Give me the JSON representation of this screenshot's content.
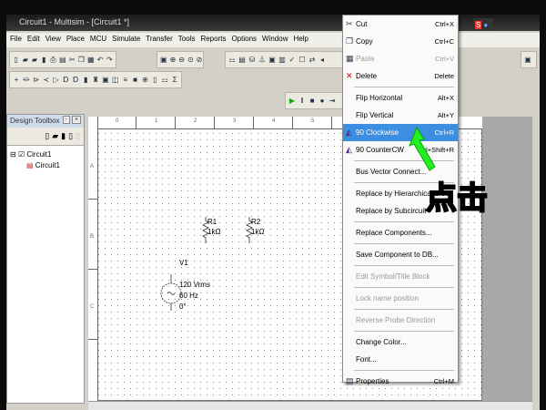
{
  "window": {
    "title": "Circuit1 - Multisim - [Circuit1 *]"
  },
  "menubar": [
    "File",
    "Edit",
    "View",
    "Place",
    "MCU",
    "Simulate",
    "Transfer",
    "Tools",
    "Reports",
    "Options",
    "Window",
    "Help"
  ],
  "design_toolbox": {
    "title": "Design Toolbox",
    "tree": {
      "root": "Circuit1",
      "child": "Circuit1"
    }
  },
  "ruler": {
    "columns": [
      "0",
      "1",
      "2",
      "3",
      "4",
      "5"
    ],
    "rows": [
      "A",
      "B",
      "C"
    ]
  },
  "schematic": {
    "r1": {
      "name": "R1",
      "value": "1kΩ"
    },
    "r2": {
      "name": "R2",
      "value": "1kΩ"
    },
    "v1": {
      "name": "V1",
      "voltage": "120 Vrms",
      "freq": "60 Hz",
      "phase": "0°"
    }
  },
  "context_menu": {
    "items": [
      {
        "label": "Cut",
        "shortcut": "Ctrl+X",
        "icon": "scissors-icon",
        "disabled": false
      },
      {
        "label": "Copy",
        "shortcut": "Ctrl+C",
        "icon": "copy-icon",
        "disabled": false
      },
      {
        "label": "Paste",
        "shortcut": "Ctrl+V",
        "icon": "paste-icon",
        "disabled": true
      },
      {
        "label": "Delete",
        "shortcut": "Delete",
        "icon": "delete-icon",
        "disabled": false,
        "sep_after": true
      },
      {
        "label": "Flip Horizontal",
        "shortcut": "Alt+X",
        "disabled": false
      },
      {
        "label": "Flip Vertical",
        "shortcut": "Alt+Y",
        "disabled": false
      },
      {
        "label": "90 Clockwise",
        "shortcut": "Ctrl+R",
        "icon": "rotate-cw-icon",
        "disabled": false,
        "highlighted": true
      },
      {
        "label": "90 CounterCW",
        "shortcut": "Ctrl+Shift+R",
        "icon": "rotate-ccw-icon",
        "disabled": false,
        "sep_after": true
      },
      {
        "label": "Bus Vector Connect...",
        "shortcut": "",
        "disabled": false,
        "sep_after": true
      },
      {
        "label": "Replace by Hierarchical Block",
        "shortcut": "",
        "disabled": false
      },
      {
        "label": "Replace by Subcircuit",
        "shortcut": "",
        "disabled": false,
        "sep_after": true
      },
      {
        "label": "Replace Components...",
        "shortcut": "",
        "disabled": false,
        "sep_after": true
      },
      {
        "label": "Save Component to DB...",
        "shortcut": "",
        "disabled": false,
        "sep_after": true
      },
      {
        "label": "Edit Symbol/Title Block",
        "shortcut": "",
        "disabled": true,
        "sep_after": true
      },
      {
        "label": "Lock name position",
        "shortcut": "",
        "disabled": true,
        "sep_after": true
      },
      {
        "label": "Reverse Probe Direction",
        "shortcut": "",
        "disabled": true,
        "sep_after": true
      },
      {
        "label": "Change Color...",
        "shortcut": "",
        "disabled": false
      },
      {
        "label": "Font...",
        "shortcut": "",
        "disabled": false,
        "sep_after": true
      },
      {
        "label": "Properties",
        "shortcut": "Ctrl+M",
        "icon": "properties-icon",
        "disabled": false
      }
    ]
  },
  "annotation": {
    "text": "点击",
    "color": "#22ee22"
  },
  "colors": {
    "highlight": "#3b8ee0",
    "title_bar": "#2a2a2a"
  }
}
